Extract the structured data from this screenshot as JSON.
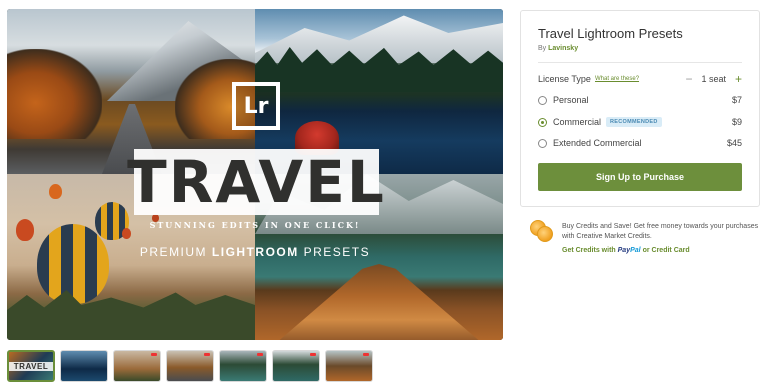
{
  "product": {
    "title": "Travel Lightroom Presets",
    "by_prefix": "By",
    "author": "Lavinsky"
  },
  "hero": {
    "logo_text": "Lr",
    "headline": "TRAVEL",
    "tagline": "STUNNING EDITS IN ONE CLICK!",
    "subtitle_prefix": "PREMIUM",
    "subtitle_bold": "LIGHTROOM",
    "subtitle_suffix": "PRESETS"
  },
  "thumbnails": [
    {
      "label": "TRAVEL",
      "active": true
    },
    {
      "label": "",
      "active": false
    },
    {
      "label": "",
      "active": false
    },
    {
      "label": "",
      "active": false
    },
    {
      "label": "",
      "active": false
    },
    {
      "label": "",
      "active": false
    },
    {
      "label": "",
      "active": false
    }
  ],
  "license": {
    "label": "License Type",
    "help_link": "What are these?",
    "seats_minus": "−",
    "seats_value": "1 seat",
    "seats_plus": "+",
    "options": [
      {
        "name": "Personal",
        "price": "$7",
        "selected": false,
        "badge": ""
      },
      {
        "name": "Commercial",
        "price": "$9",
        "selected": true,
        "badge": "RECOMMENDED"
      },
      {
        "name": "Extended Commercial",
        "price": "$45",
        "selected": false,
        "badge": ""
      }
    ],
    "cta": "Sign Up to Purchase"
  },
  "credits": {
    "text": "Buy Credits and Save! Get free money towards your purchases with Creative Market Credits.",
    "link_prefix": "Get Credits with",
    "paypal_pay": "Pay",
    "paypal_pal": "Pal",
    "link_suffix": "or Credit Card"
  },
  "colors": {
    "accent_green": "#6d8f3c",
    "link_green": "#6a8d2f",
    "badge_bg": "#d9ecf7",
    "badge_text": "#4a8ab3"
  }
}
